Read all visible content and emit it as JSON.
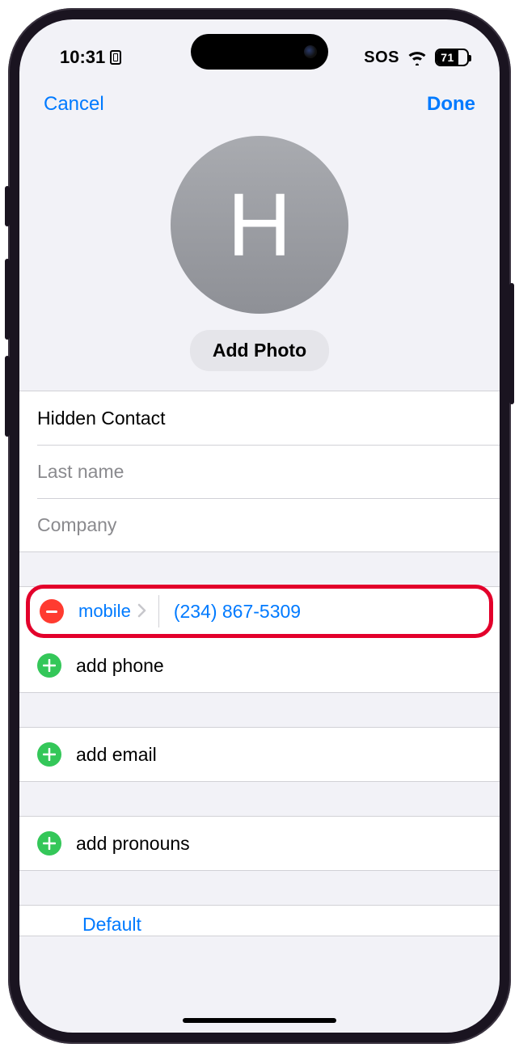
{
  "statusBar": {
    "time": "10:31",
    "sos": "SOS",
    "battery": "71"
  },
  "nav": {
    "cancel": "Cancel",
    "done": "Done"
  },
  "avatar": {
    "initial": "H",
    "addPhoto": "Add Photo"
  },
  "fields": {
    "firstName": "Hidden Contact",
    "lastNamePlaceholder": "Last name",
    "companyPlaceholder": "Company"
  },
  "phone": {
    "typeLabel": "mobile",
    "value": "(234) 867-5309",
    "addLabel": "add phone"
  },
  "email": {
    "addLabel": "add email"
  },
  "pronouns": {
    "addLabel": "add pronouns"
  },
  "ringtone": {
    "value": "Default"
  }
}
